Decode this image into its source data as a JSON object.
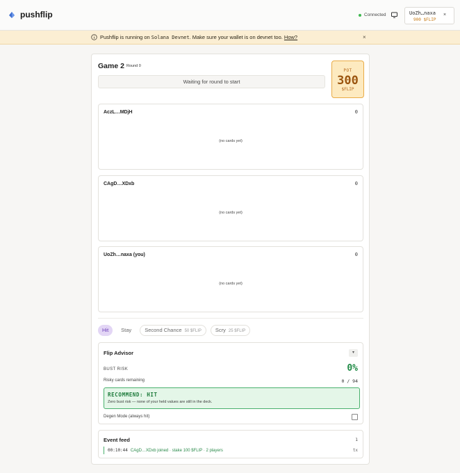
{
  "header": {
    "brand": "pushflip",
    "connection": "Connected",
    "wallet": {
      "address": "UoZh…naxa",
      "balance": "900 $FLIP",
      "close": "×"
    }
  },
  "banner": {
    "prefix": "Pushflip is running on ",
    "network": "Solana Devnet",
    "suffix": ". Make sure your wallet is on devnet too. ",
    "link": "How?",
    "close": "×"
  },
  "game": {
    "title": "Game 2",
    "round": "Round 0",
    "status": "Waiting for round to start",
    "pot": {
      "label": "POT",
      "value": "300",
      "unit": "$FLIP"
    }
  },
  "players": [
    {
      "name": "AczL…MDjH",
      "score": "0",
      "empty": "(no cards yet)"
    },
    {
      "name": "CAgD…XDxb",
      "score": "0",
      "empty": "(no cards yet)"
    },
    {
      "name": "UoZh…naxa (you)",
      "score": "0",
      "empty": "(no cards yet)"
    }
  ],
  "actions": {
    "hit": "Hit",
    "stay": "Stay",
    "second_chance": {
      "label": "Second Chance",
      "cost": "50 $FLIP"
    },
    "scry": {
      "label": "Scry",
      "cost": "25 $FLIP"
    }
  },
  "advisor": {
    "title": "Flip Advisor",
    "toggle": "▾",
    "bust_label": "BUST RISK",
    "bust_value": "0%",
    "risky_label": "Risky cards remaining",
    "risky_value": "0 / 94",
    "recommend_title": "RECOMMEND: HIT",
    "recommend_desc": "Zero bust risk — none of your held values are still in the deck.",
    "degen_label": "Degen Mode (always hit)"
  },
  "feed": {
    "title": "Event feed",
    "count": "1",
    "events": [
      {
        "time": "00:10:44",
        "message": "CAgD…XDxb joined · stake 100 $FLIP · 2 players",
        "tx": "tx"
      }
    ]
  },
  "colors": {
    "accent": "#6a3cb8",
    "success": "#1f8a45",
    "pot": "#9b5510",
    "warning_bg": "#fbeed3"
  }
}
